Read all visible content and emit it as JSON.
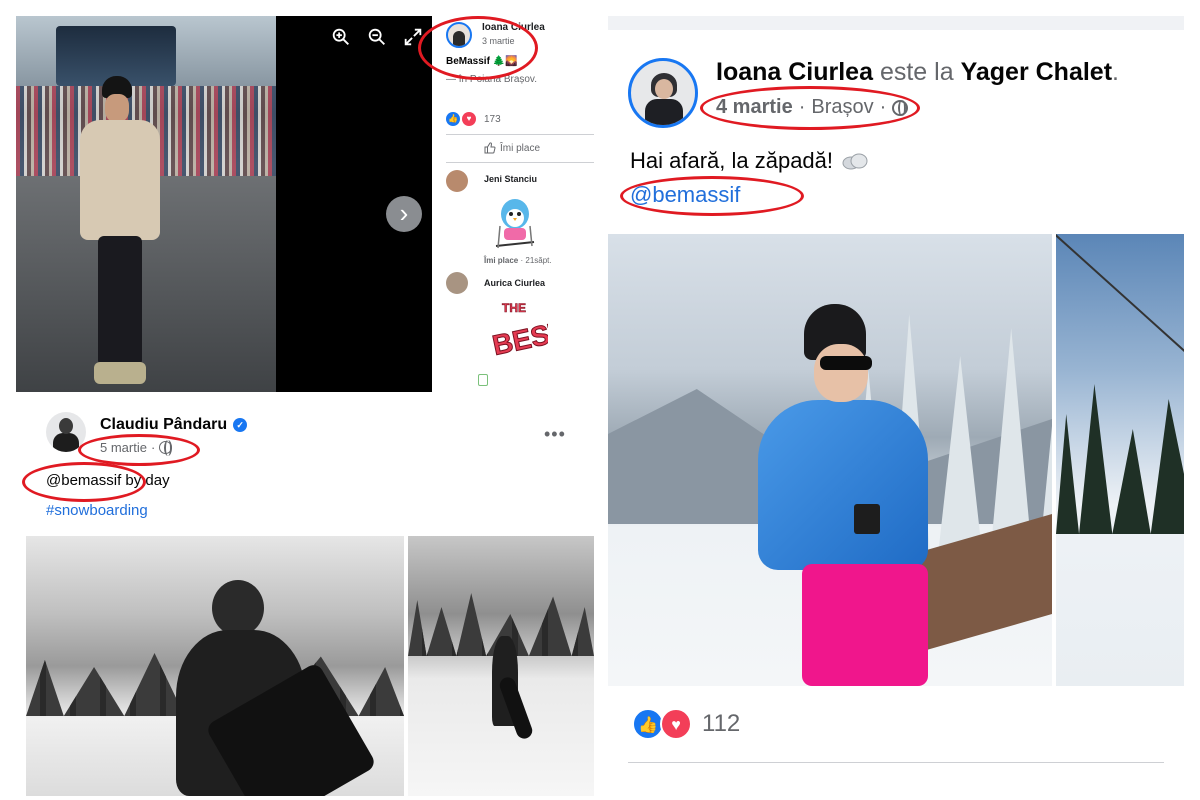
{
  "colors": {
    "fb_blue": "#1877f2",
    "link_blue": "#216fdb",
    "annotation_red": "#e01a22",
    "love_red": "#f33e58",
    "meta_gray": "#65676b"
  },
  "post_a": {
    "author": "Ioana Ciurlea",
    "date": "3 martie",
    "caption": "BeMassif 🌲🌄",
    "location": "— în Poiana Brașov.",
    "reaction_count": "173",
    "like_button": "Îmi place",
    "viewer_icons": [
      "zoom-in-icon",
      "zoom-out-icon",
      "fullscreen-icon"
    ],
    "next_icon": "chevron-right-icon",
    "comments": [
      {
        "author": "Jeni Stanciu",
        "like_label": "Îmi place",
        "time": "21săpt."
      },
      {
        "author": "Aurica Ciurlea"
      }
    ],
    "sticker2_text": "THE BEST"
  },
  "post_b": {
    "author": "Claudiu Pândaru",
    "date": "5 martie",
    "separator": "·",
    "text": "@bemassif by day",
    "hashtag": "#snowboarding",
    "more": "•••"
  },
  "post_c": {
    "author": "Ioana Ciurlea",
    "connector": "este la",
    "place": "Yager Chalet",
    "date": "4 martie",
    "separator": "·",
    "city": "Brașov",
    "text": "Hai afară, la zăpadă!",
    "mention": "@bemassif",
    "reaction_count": "112"
  }
}
